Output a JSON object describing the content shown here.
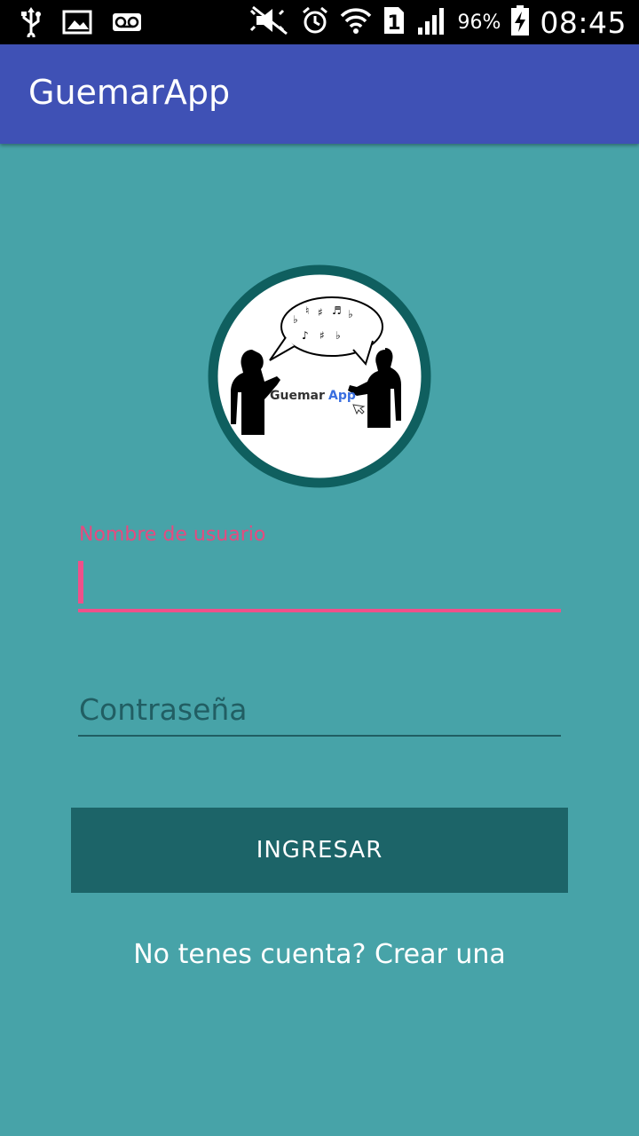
{
  "status_bar": {
    "left_icons": [
      "usb-icon",
      "image-icon",
      "voicemail-icon"
    ],
    "right_icons": [
      "mute-icon",
      "alarm-icon",
      "wifi-icon",
      "sim-1-icon",
      "signal-icon",
      "battery-charging-icon"
    ],
    "battery_percent": "96%",
    "time": "08:45"
  },
  "app_bar": {
    "title": "GuemarApp"
  },
  "logo": {
    "text_primary": "Guemar",
    "text_accent": "App",
    "accent_color": "#3A6FE0",
    "ring_color": "#0F5F5F"
  },
  "form": {
    "username_label": "Nombre de usuario",
    "username_value": "",
    "password_placeholder": "Contraseña",
    "submit_label": "INGRESAR",
    "signup_link": "No tenes cuenta? Crear una"
  },
  "colors": {
    "background": "#47A3A8",
    "app_bar": "#3F51B5",
    "accent_pink": "#F0508A",
    "button": "#1C6468"
  }
}
